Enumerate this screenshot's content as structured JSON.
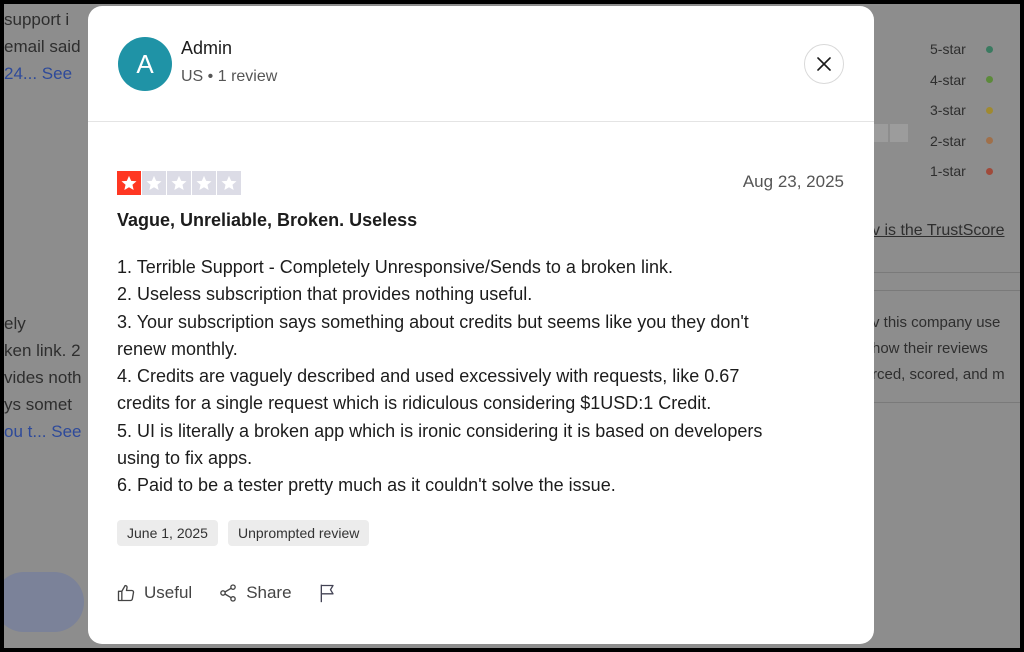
{
  "background": {
    "left_top_lines": [
      "support i",
      "email said",
      "24... See"
    ],
    "left_mid_lines": [
      "ely",
      "ken link. 2",
      "vides noth",
      "ys somet",
      "ou t... See"
    ],
    "rating_rows": [
      {
        "label": "5-star",
        "color": "#04da8d"
      },
      {
        "label": "4-star",
        "color": "#73cf11"
      },
      {
        "label": "3-star",
        "color": "#ffce00"
      },
      {
        "label": "2-star",
        "color": "#ff8622"
      },
      {
        "label": "1-star",
        "color": "#ff3722"
      }
    ],
    "trustscore_link": "v is the TrustScore",
    "right_lines": [
      "v this company use",
      "how their reviews",
      "rced, scored, and m"
    ]
  },
  "review": {
    "author": {
      "initial": "A",
      "name": "Admin",
      "meta": "US • 1 review"
    },
    "rating": 1,
    "rating_max": 5,
    "date": "Aug 23, 2025",
    "title": "Vague, Unreliable, Broken. Useless",
    "body_lines": [
      "1. Terrible Support - Completely Unresponsive/Sends to a broken link.",
      "2. Useless subscription that provides nothing useful.",
      "3. Your subscription says something about credits but seems like you they don't",
      "renew monthly.",
      "4. Credits are vaguely described and used excessively with requests, like 0.67",
      "credits for a single request which is ridiculous considering $1USD:1 Credit.",
      "5. UI is literally a broken app which is ironic considering it is based on developers",
      "using to fix apps.",
      "6. Paid to be a tester pretty much as it couldn't solve the issue."
    ],
    "tags": [
      "June 1, 2025",
      "Unprompted review"
    ],
    "actions": {
      "useful": "Useful",
      "share": "Share"
    }
  },
  "icons": {
    "close": "close-icon",
    "useful": "thumbs-up-icon",
    "share": "share-icon",
    "flag": "flag-icon",
    "star": "star-icon"
  },
  "colors": {
    "avatar_bg": "#1f93a6",
    "star_filled": "#ff3722",
    "star_empty": "#dcdce6",
    "overlay": "#8d8d8d"
  }
}
